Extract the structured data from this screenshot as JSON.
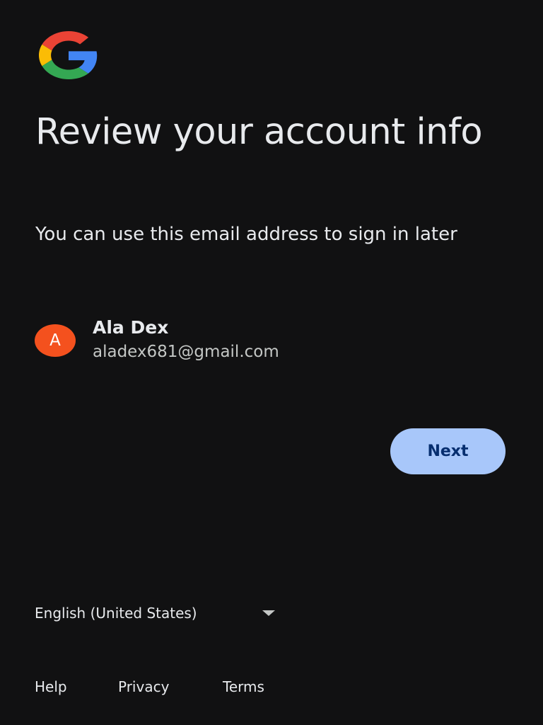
{
  "logo": {
    "icon": "google-g-logo",
    "colors": {
      "red": "#ea4335",
      "yellow": "#fbbc05",
      "green": "#34a853",
      "blue": "#4285f4"
    }
  },
  "header": {
    "title": "Review your account info",
    "subtitle": "You can use this email address to sign in later"
  },
  "account": {
    "avatar_letter": "A",
    "avatar_color": "#f4511e",
    "name": "Ala Dex",
    "email": "aladex681@gmail.com"
  },
  "actions": {
    "next_label": "Next",
    "next_color": "#a8c7fa"
  },
  "language": {
    "selected": "English (United States)",
    "icon": "dropdown-caret-icon"
  },
  "footer": {
    "help": "Help",
    "privacy": "Privacy",
    "terms": "Terms"
  }
}
